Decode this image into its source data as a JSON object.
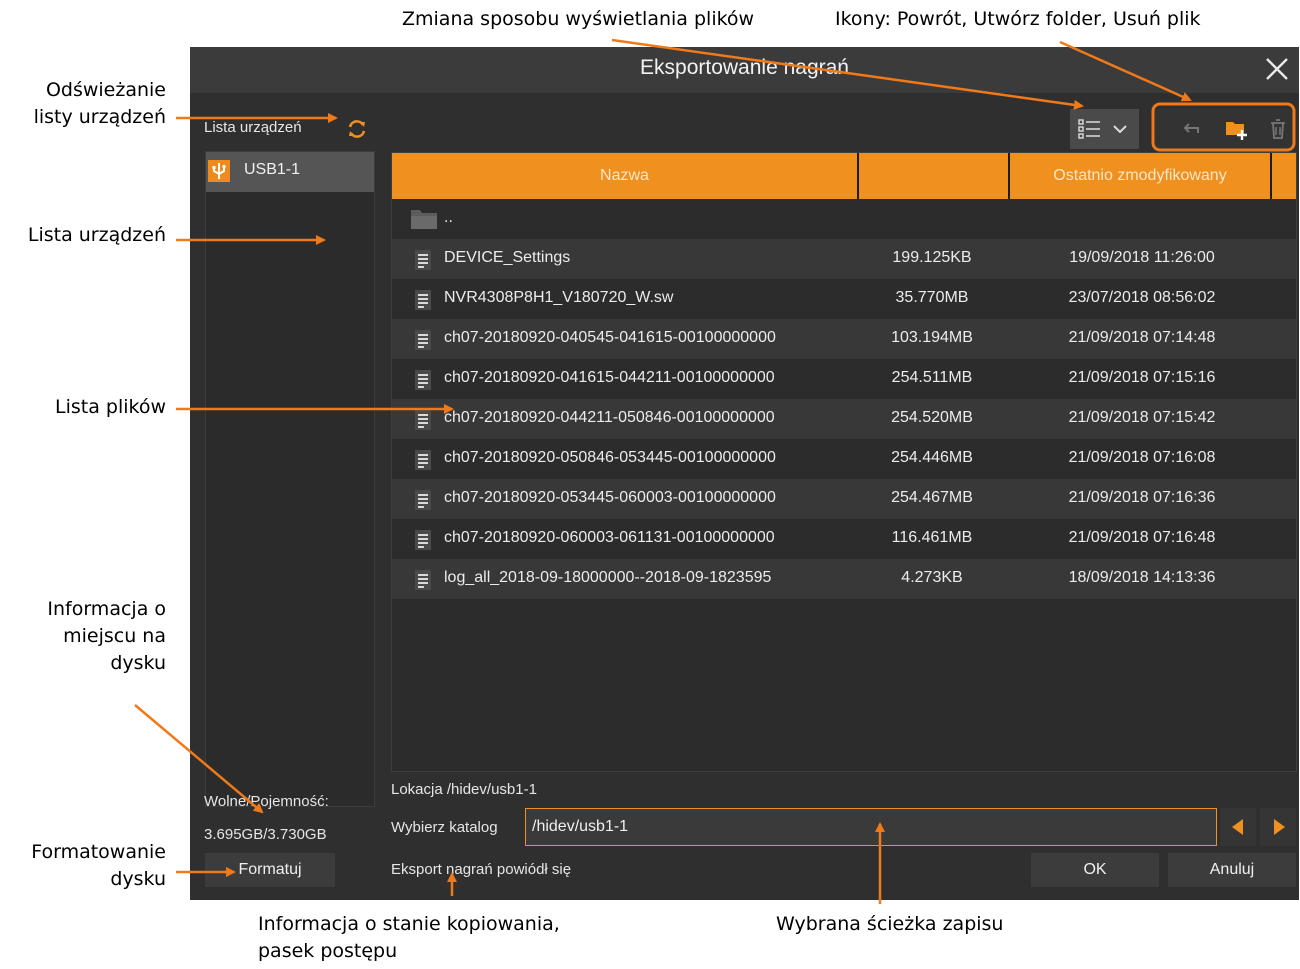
{
  "annotations": {
    "view_mode": "Zmiana sposobu wyświetlania plików",
    "icons": "Ikony: Powrót, Utwórz folder, Usuń plik",
    "refresh_line1": "Odświeżanie",
    "refresh_line2": "listy urządzeń",
    "device_list": "Lista urządzeń",
    "file_list": "Lista plików",
    "disk_info_1": "Informacja o",
    "disk_info_2": "miejscu na",
    "disk_info_3": "dysku",
    "format_1": "Formatowanie",
    "format_2": "dysku",
    "status_1": "Informacja o stanie kopiowania,",
    "status_2": "pasek postępu",
    "path": "Wybrana ścieżka zapisu"
  },
  "dialog": {
    "title": "Eksportowanie nagrań",
    "device_list_label": "Lista urządzeń",
    "devices": [
      {
        "label": "USB1-1"
      }
    ],
    "capacity_label": "Wolne/Pojemność:",
    "capacity_value": "3.695GB/3.730GB",
    "format_button": "Formatuj",
    "location_label": "Lokacja /hidev/usb1-1",
    "choose_dir_label": "Wybierz katalog",
    "choose_dir_value": "/hidev/usb1-1",
    "status_text": "Eksport nagrań powiódł się",
    "ok_button": "OK",
    "cancel_button": "Anuluj",
    "columns": {
      "name": "Nazwa",
      "size": "",
      "modified": "Ostatnio zmodyfikowany"
    },
    "parent_dir": "..",
    "files": [
      {
        "name": "DEVICE_Settings",
        "size": "199.125KB",
        "date": "19/09/2018 11:26:00"
      },
      {
        "name": "NVR4308P8H1_V180720_W.sw",
        "size": "35.770MB",
        "date": "23/07/2018 08:56:02"
      },
      {
        "name": "ch07-20180920-040545-041615-00100000000",
        "size": "103.194MB",
        "date": "21/09/2018 07:14:48"
      },
      {
        "name": "ch07-20180920-041615-044211-00100000000",
        "size": "254.511MB",
        "date": "21/09/2018 07:15:16"
      },
      {
        "name": "ch07-20180920-044211-050846-00100000000",
        "size": "254.520MB",
        "date": "21/09/2018 07:15:42"
      },
      {
        "name": "ch07-20180920-050846-053445-00100000000",
        "size": "254.446MB",
        "date": "21/09/2018 07:16:08"
      },
      {
        "name": "ch07-20180920-053445-060003-00100000000",
        "size": "254.467MB",
        "date": "21/09/2018 07:16:36"
      },
      {
        "name": "ch07-20180920-060003-061131-00100000000",
        "size": "116.461MB",
        "date": "21/09/2018 07:16:48"
      },
      {
        "name": "log_all_2018-09-18000000--2018-09-1823595",
        "size": "4.273KB",
        "date": "18/09/2018 14:13:36"
      }
    ]
  },
  "colors": {
    "accent": "#f0901e",
    "background": "#2f2f2f",
    "arrow": "#f07a1a"
  },
  "icons": [
    "close-icon",
    "refresh-icon",
    "usb-icon",
    "list-view-icon",
    "chevron-down-icon",
    "back-icon",
    "new-folder-icon",
    "trash-icon",
    "folder-icon",
    "file-icon",
    "arrow-left-icon",
    "arrow-right-icon"
  ]
}
